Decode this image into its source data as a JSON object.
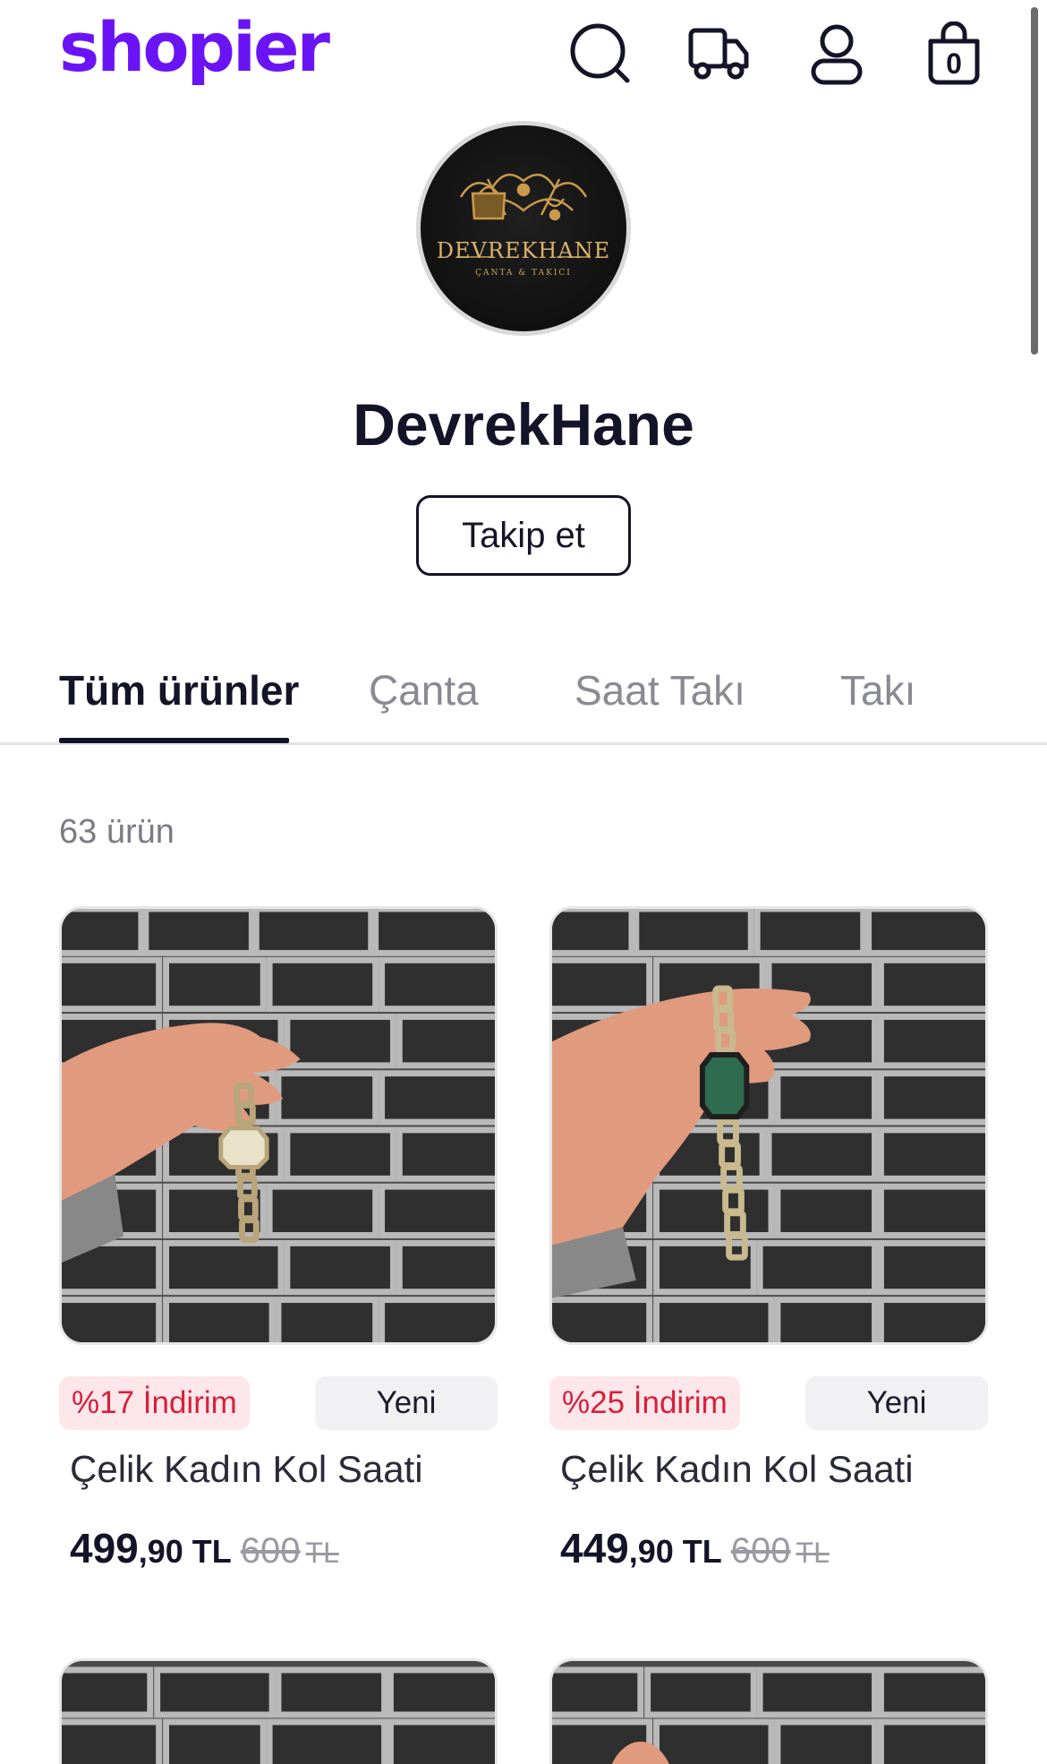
{
  "header": {
    "logo": "shopier",
    "icons": [
      "search-icon",
      "truck-icon",
      "user-icon",
      "cart-icon"
    ],
    "cart_count": "0",
    "accent_color": "#6a14f5"
  },
  "store": {
    "avatar_brand": "DEVREKHANE",
    "avatar_sub": "ÇANTA & TAKICI",
    "name": "DevrekHane",
    "follow_label": "Takip et"
  },
  "tabs": [
    {
      "label": "Tüm ürünler",
      "active": true
    },
    {
      "label": "Çanta",
      "active": false
    },
    {
      "label": "Saat Takı",
      "active": false
    },
    {
      "label": "Takı",
      "active": false
    }
  ],
  "product_count": "63 ürün",
  "products": [
    {
      "discount": "%17 İndirim",
      "badge": "Yeni",
      "title": "Çelik Kadın Kol Saati",
      "price_main": "499",
      "price_decimals": ",90",
      "currency": "TL",
      "old_price": "600",
      "old_currency": "TL"
    },
    {
      "discount": "%25 İndirim",
      "badge": "Yeni",
      "title": "Çelik Kadın Kol Saati",
      "price_main": "449",
      "price_decimals": ",90",
      "currency": "TL",
      "old_price": "600",
      "old_currency": "TL"
    }
  ]
}
